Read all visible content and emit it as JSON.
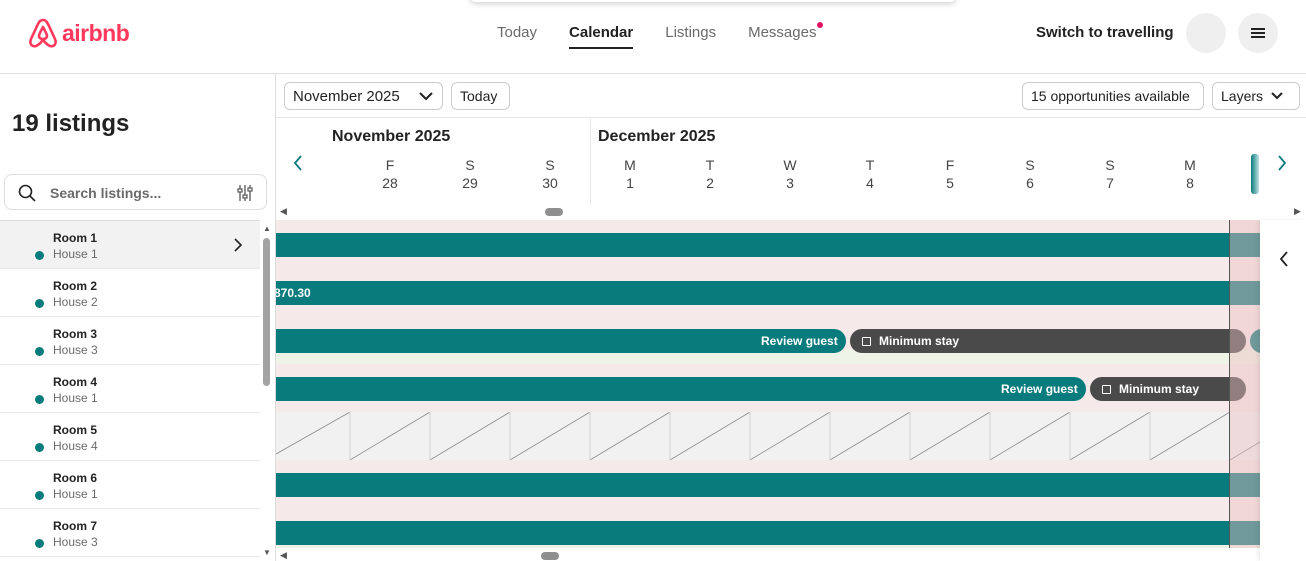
{
  "brand": {
    "name": "airbnb",
    "color": "#ff385c"
  },
  "nav": {
    "today": "Today",
    "calendar": "Calendar",
    "listings": "Listings",
    "messages": "Messages"
  },
  "header": {
    "switch_label": "Switch to travelling"
  },
  "sidebar": {
    "count_title": "19 listings",
    "search_placeholder": "Search listings...",
    "rows": [
      {
        "name": "Room 1",
        "house": "House 1"
      },
      {
        "name": "Room 2",
        "house": "House 2"
      },
      {
        "name": "Room 3",
        "house": "House 3"
      },
      {
        "name": "Room 4",
        "house": "House 1"
      },
      {
        "name": "Room 5",
        "house": "House 4"
      },
      {
        "name": "Room 6",
        "house": "House 1"
      },
      {
        "name": "Room 7",
        "house": "House 3"
      }
    ]
  },
  "calendar": {
    "month_picker": "November 2025",
    "today_button": "Today",
    "opportunities": "15 opportunities available",
    "layers": "Layers",
    "month_nov": "November 2025",
    "month_dec": "December 2025",
    "days": [
      {
        "dow": "F",
        "date": "28"
      },
      {
        "dow": "S",
        "date": "29"
      },
      {
        "dow": "S",
        "date": "30"
      },
      {
        "dow": "M",
        "date": "1"
      },
      {
        "dow": "T",
        "date": "2"
      },
      {
        "dow": "W",
        "date": "3"
      },
      {
        "dow": "T",
        "date": "4"
      },
      {
        "dow": "F",
        "date": "5"
      },
      {
        "dow": "S",
        "date": "6"
      },
      {
        "dow": "S",
        "date": "7"
      },
      {
        "dow": "M",
        "date": "8"
      }
    ],
    "price_label": "870.30",
    "review_guest": "Review guest",
    "minimum_stay": "Minimum stay",
    "colors": {
      "booking": "#0a7b7c",
      "chip": "#4a4a4a"
    }
  }
}
